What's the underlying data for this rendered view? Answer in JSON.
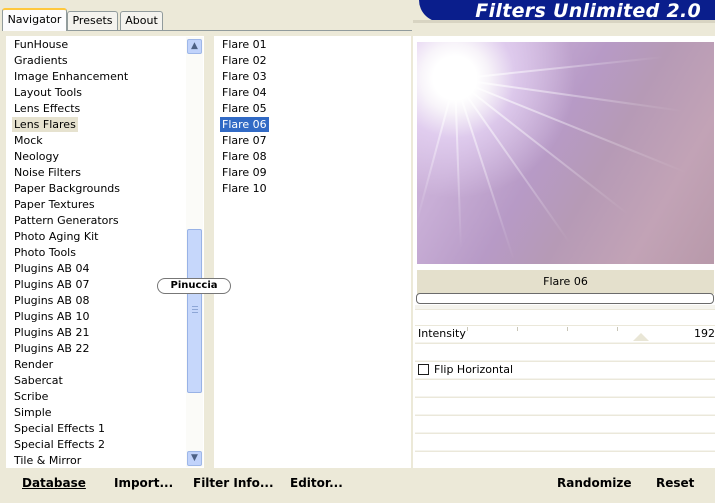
{
  "tabs": [
    {
      "label": "Navigator",
      "active": true
    },
    {
      "label": "Presets",
      "active": false
    },
    {
      "label": "About",
      "active": false
    }
  ],
  "app_title": "Filters Unlimited 2.0",
  "categories": [
    "FunHouse",
    "Gradients",
    "Image Enhancement",
    "Layout Tools",
    "Lens Effects",
    "Lens Flares",
    "Mock",
    "Neology",
    "Noise Filters",
    "Paper Backgrounds",
    "Paper Textures",
    "Pattern Generators",
    "Photo Aging Kit",
    "Photo Tools",
    "Plugins AB 04",
    "Plugins AB 07",
    "Plugins AB 08",
    "Plugins AB 10",
    "Plugins AB 21",
    "Plugins AB 22",
    "Render",
    "Sabercat",
    "Scribe",
    "Simple",
    "Special Effects 1",
    "Special Effects 2",
    "Tile & Mirror"
  ],
  "selected_category": "Lens Flares",
  "filters": [
    "Flare 01",
    "Flare 02",
    "Flare 03",
    "Flare 04",
    "Flare 05",
    "Flare 06",
    "Flare 07",
    "Flare 08",
    "Flare 09",
    "Flare 10"
  ],
  "selected_filter": "Flare 06",
  "watermark": "Pinuccia",
  "preview": {
    "filter_name": "Flare 06"
  },
  "params": {
    "intensity_label": "Intensity",
    "intensity_value": "192",
    "flip_label": "Flip Horizontal",
    "flip_checked": false
  },
  "bottom_buttons": {
    "database": "Database",
    "import": "Import...",
    "filter_info": "Filter Info...",
    "editor": "Editor...",
    "randomize": "Randomize",
    "reset": "Reset"
  },
  "colors": {
    "window_bg": "#ece9d8",
    "banner_bg": "#0a1e8c",
    "selection_blue": "#316ac5",
    "category_highlight": "#e6e2cf"
  }
}
